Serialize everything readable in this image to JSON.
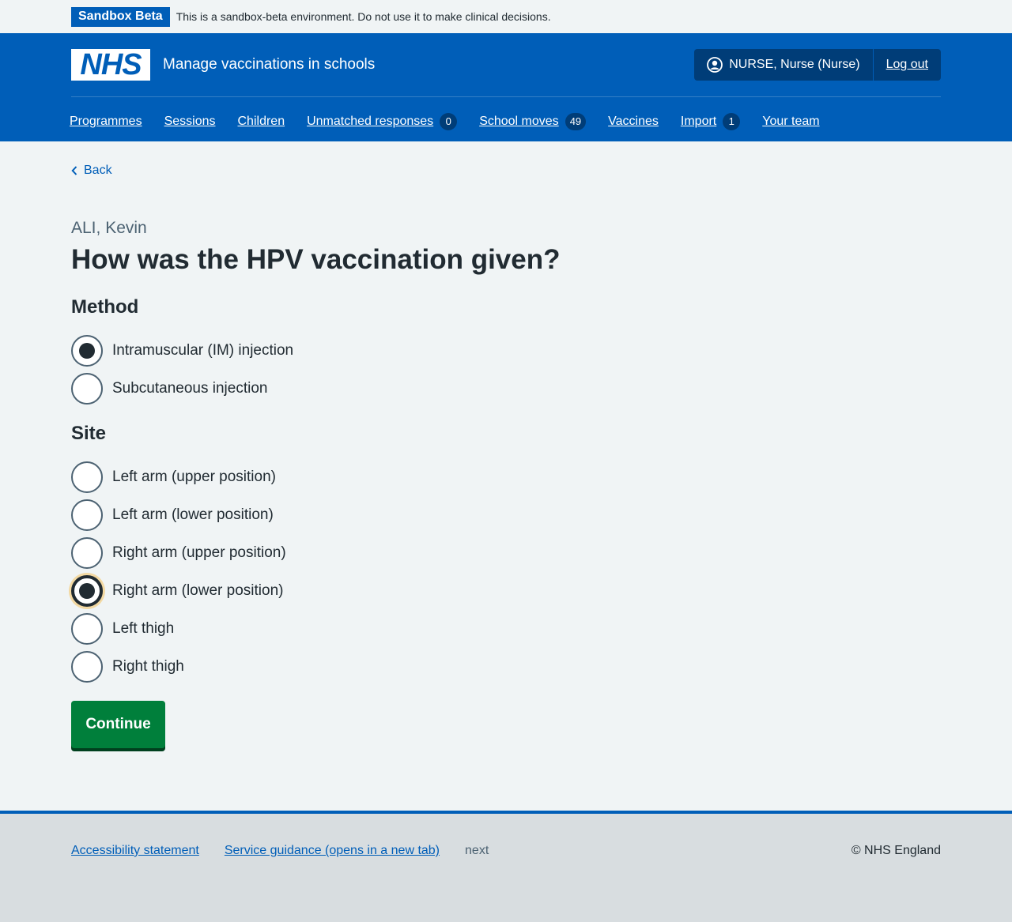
{
  "env_banner": {
    "tag": "Sandbox Beta",
    "text": "This is a sandbox-beta environment. Do not use it to make clinical decisions."
  },
  "header": {
    "logo_text": "NHS",
    "service_name": "Manage vaccinations in schools",
    "account": {
      "user_label": "NURSE, Nurse (Nurse)",
      "logout_label": "Log out"
    },
    "nav": [
      {
        "label": "Programmes"
      },
      {
        "label": "Sessions"
      },
      {
        "label": "Children"
      },
      {
        "label": "Unmatched responses",
        "count": "0"
      },
      {
        "label": "School moves",
        "count": "49"
      },
      {
        "label": "Vaccines"
      },
      {
        "label": "Import",
        "count": "1"
      },
      {
        "label": "Your team"
      }
    ]
  },
  "main": {
    "back_label": "Back",
    "caption": "ALI, Kevin",
    "title": "How was the HPV vaccination given?",
    "method": {
      "legend": "Method",
      "options": [
        {
          "label": "Intramuscular (IM) injection",
          "checked": true
        },
        {
          "label": "Subcutaneous injection",
          "checked": false
        }
      ]
    },
    "site": {
      "legend": "Site",
      "options": [
        {
          "label": "Left arm (upper position)",
          "checked": false
        },
        {
          "label": "Left arm (lower position)",
          "checked": false
        },
        {
          "label": "Right arm (upper position)",
          "checked": false
        },
        {
          "label": "Right arm (lower position)",
          "checked": true
        },
        {
          "label": "Left thigh",
          "checked": false
        },
        {
          "label": "Right thigh",
          "checked": false
        }
      ]
    },
    "continue_label": "Continue"
  },
  "footer": {
    "links": [
      {
        "label": "Accessibility statement"
      },
      {
        "label": "Service guidance (opens in a new tab)"
      }
    ],
    "version": "next",
    "copyright": "© NHS England"
  },
  "colors": {
    "nhs_blue": "#005eb8",
    "dark_blue": "#003d78",
    "green": "#007f3b",
    "text": "#212b32",
    "secondary_text": "#4c6272",
    "background": "#f0f4f5",
    "footer_bg": "#d8dde0"
  }
}
